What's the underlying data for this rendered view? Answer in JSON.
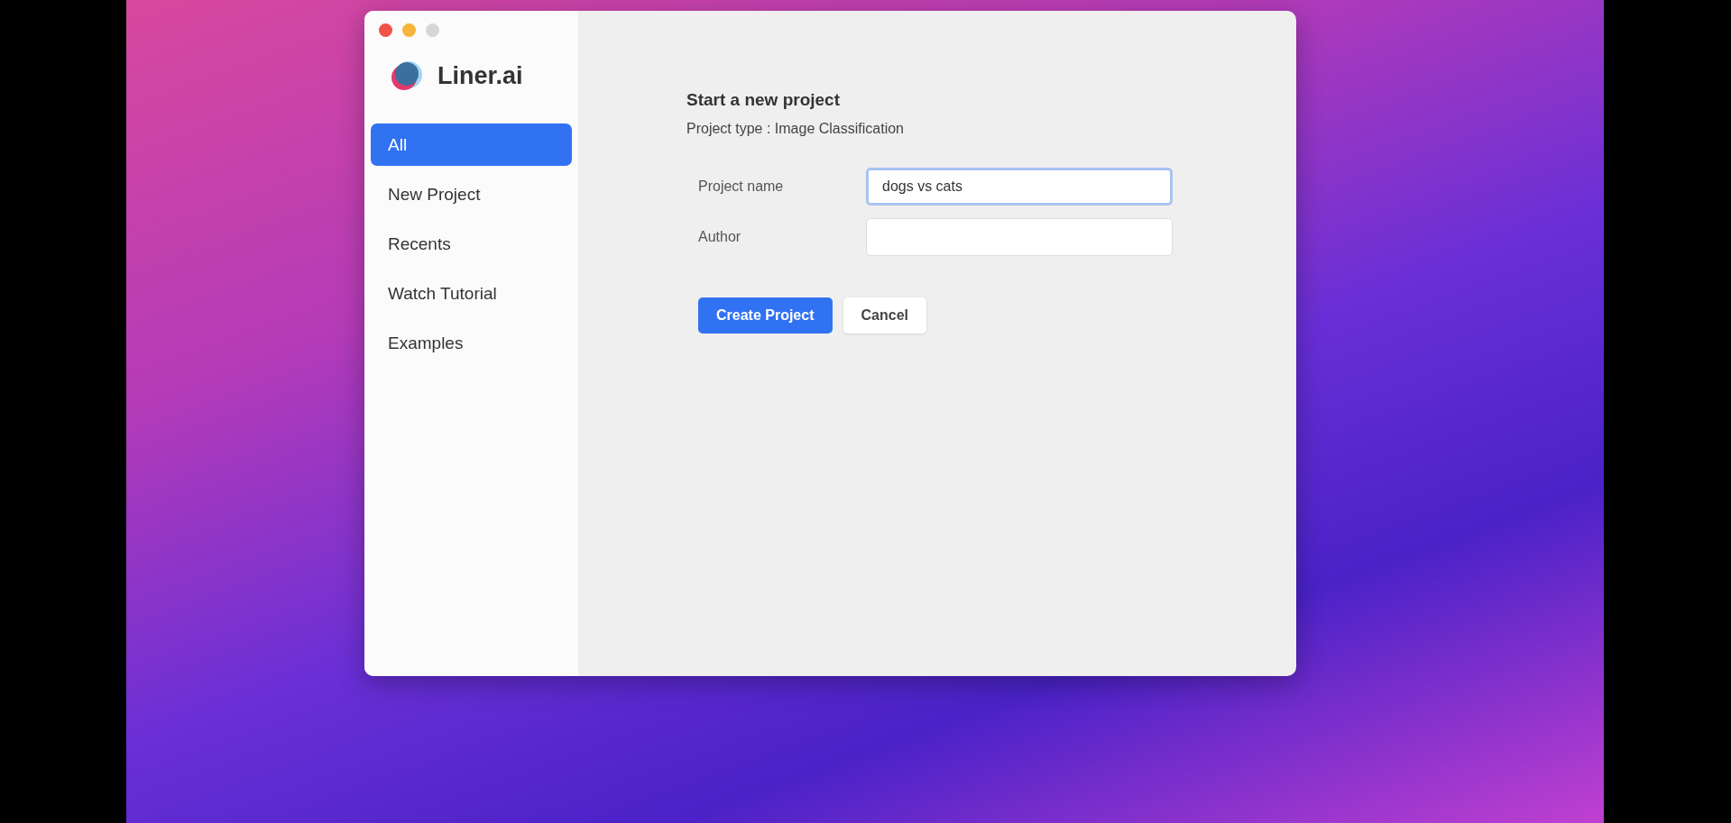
{
  "app": {
    "name": "Liner.ai"
  },
  "sidebar": {
    "items": [
      {
        "label": "All",
        "selected": true
      },
      {
        "label": "New Project",
        "selected": false
      },
      {
        "label": "Recents",
        "selected": false
      },
      {
        "label": "Watch Tutorial",
        "selected": false
      },
      {
        "label": "Examples",
        "selected": false
      }
    ]
  },
  "form": {
    "title": "Start a new project",
    "subtitle": "Project type : Image Classification",
    "fields": [
      {
        "label": "Project name",
        "value": "dogs vs cats",
        "focused": true
      },
      {
        "label": "Author",
        "focused": false
      }
    ],
    "buttons": [
      {
        "label": "Create Project",
        "kind": "primary"
      },
      {
        "label": "Cancel",
        "kind": "secondary"
      }
    ]
  }
}
